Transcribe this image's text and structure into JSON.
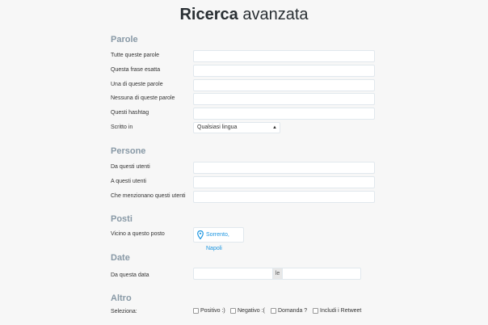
{
  "title": {
    "bold": "Ricerca",
    "rest": "avanzata"
  },
  "sections": {
    "words": "Parole",
    "people": "Persone",
    "places": "Posti",
    "date": "Date",
    "other": "Altro"
  },
  "words": {
    "all": "Tutte queste parole",
    "exact": "Questa frase esatta",
    "any": "Una di queste parole",
    "none": "Nessuna di queste parole",
    "hashtags": "Questi hashtag",
    "language_label": "Scritto in",
    "language_value": "Qualsiasi lingua"
  },
  "people": {
    "from": "Da questi utenti",
    "to": "A questi utenti",
    "mentioning": "Che menzionano questi utenti"
  },
  "places": {
    "near_label": "Vicino a questo posto",
    "near_value": "Sorrento, Napoli"
  },
  "date": {
    "from_label": "Da questa data",
    "separator": "le"
  },
  "other": {
    "select_label": "Seleziona:",
    "options": [
      "Positivo :)",
      "Negativo :(",
      "Domanda ?",
      "Includi i Retweet"
    ]
  },
  "colors": {
    "section": "#8899a6",
    "link": "#1b95e0"
  }
}
